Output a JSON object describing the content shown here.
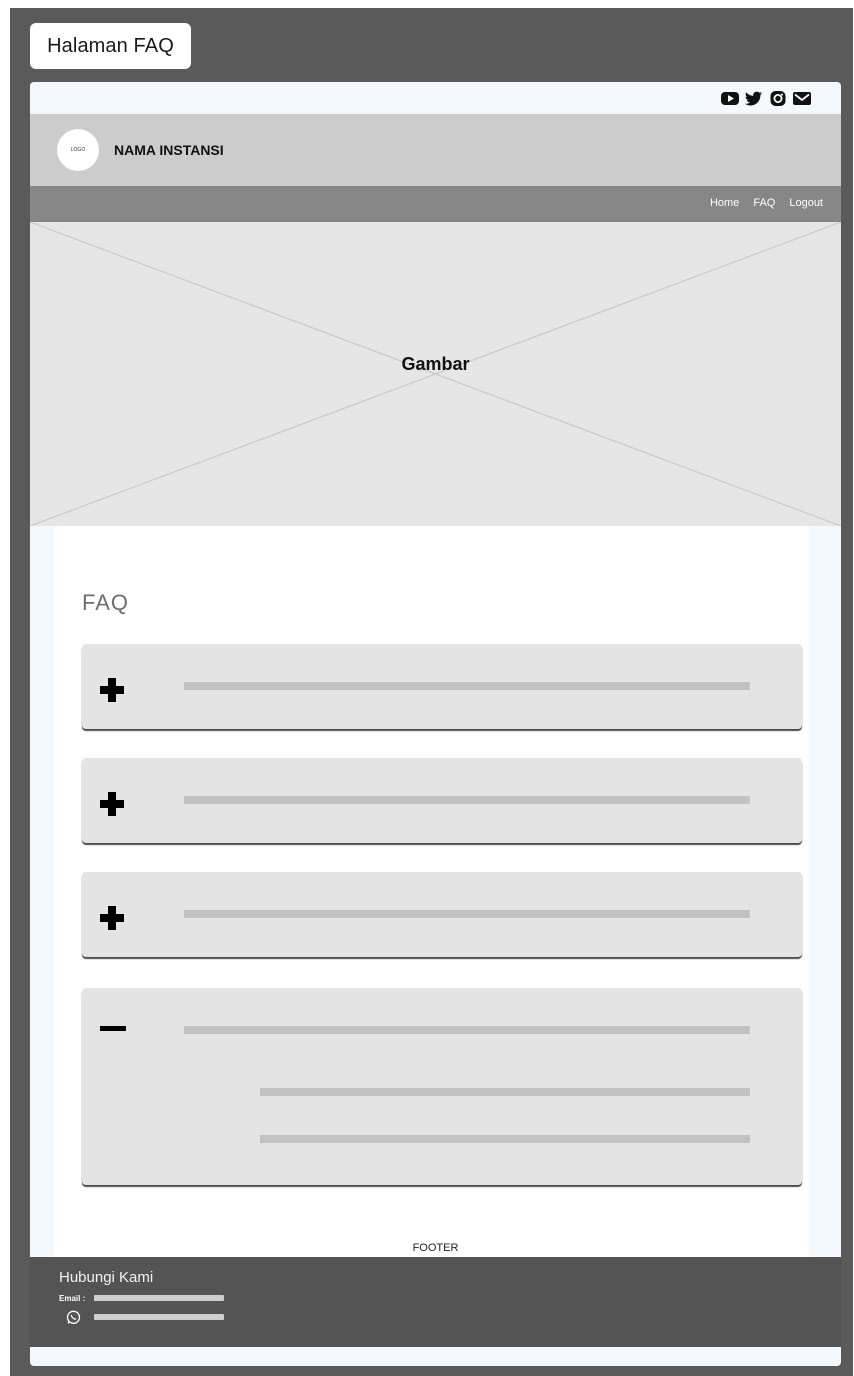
{
  "page_tab": {
    "label": "Halaman FAQ"
  },
  "social": {
    "icons": [
      "youtube-icon",
      "twitter-icon",
      "instagram-icon",
      "mail-icon"
    ]
  },
  "header": {
    "logo_text": "LOGO",
    "org_name": "NAMA INSTANSI"
  },
  "nav": {
    "home": "Home",
    "faq": "FAQ",
    "logout": "Logout"
  },
  "hero": {
    "label": "Gambar"
  },
  "faq": {
    "title": "FAQ",
    "items": [
      {
        "state": "collapsed",
        "toggle_icon": "plus-icon"
      },
      {
        "state": "collapsed",
        "toggle_icon": "plus-icon"
      },
      {
        "state": "collapsed",
        "toggle_icon": "plus-icon"
      },
      {
        "state": "expanded",
        "toggle_icon": "minus-icon"
      }
    ]
  },
  "footer": {
    "label": "FOOTER",
    "title": "Hubungi Kami",
    "email_label": "Email :",
    "whatsapp_icon": "whatsapp-icon"
  },
  "colors": {
    "frame": "#5a5a5a",
    "window_bg": "#f3f9ff",
    "header_bg": "#cccccc",
    "nav_bg": "#878787",
    "hero_bg": "#e6e6e6",
    "faq_item_bg": "#e4e4e4",
    "footer_bg": "#545454"
  }
}
